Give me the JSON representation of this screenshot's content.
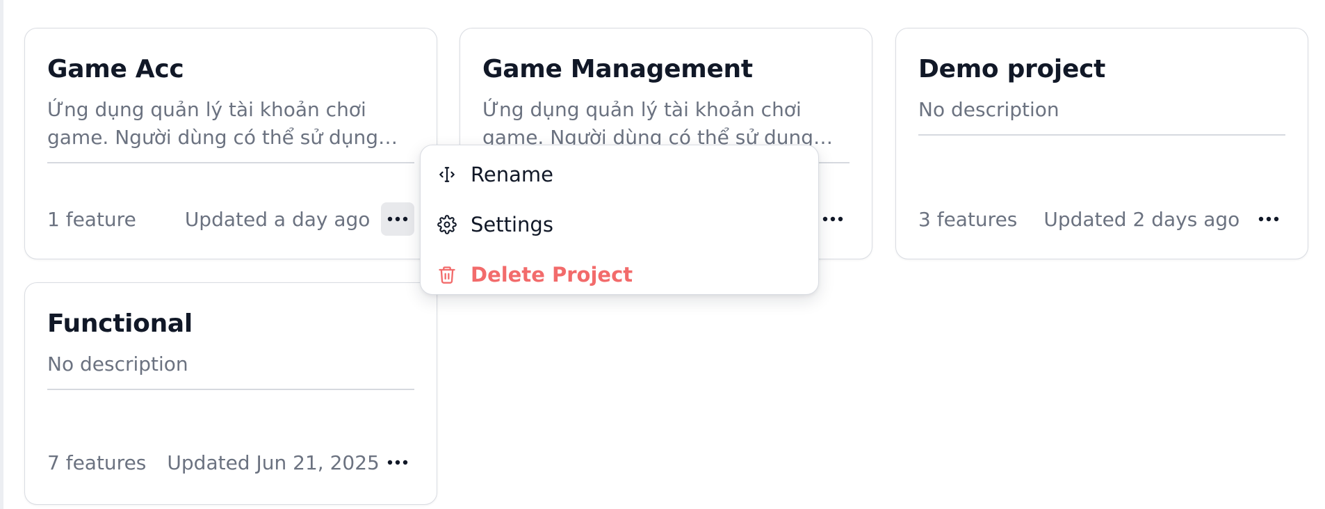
{
  "projects": [
    {
      "title": "Game Acc",
      "description": "Ứng dụng quản lý tài khoản chơi game. Người dùng có thể sử dụng ứng dụng để quản lý tài khoản",
      "features": "1 feature",
      "updated": "Updated a day ago"
    },
    {
      "title": "Game Management",
      "description": "Ứng dụng quản lý tài khoản chơi game. Người dùng có thể sử dụng ứng dụng để quản lý tài khoản",
      "features": "",
      "updated": ""
    },
    {
      "title": "Demo project",
      "description": "No description",
      "features": "3 features",
      "updated": "Updated 2 days ago"
    },
    {
      "title": "Functional",
      "description": "No description",
      "features": "7 features",
      "updated": "Updated Jun 21, 2025"
    }
  ],
  "context_menu": {
    "rename": "Rename",
    "settings": "Settings",
    "delete": "Delete Project"
  },
  "colors": {
    "danger": "#f26b6b",
    "title": "#111827",
    "muted": "#6b7280"
  },
  "icons": {
    "more": "more-horizontal-icon",
    "rename": "text-cursor-icon",
    "settings": "gear-icon",
    "delete": "trash-icon"
  }
}
